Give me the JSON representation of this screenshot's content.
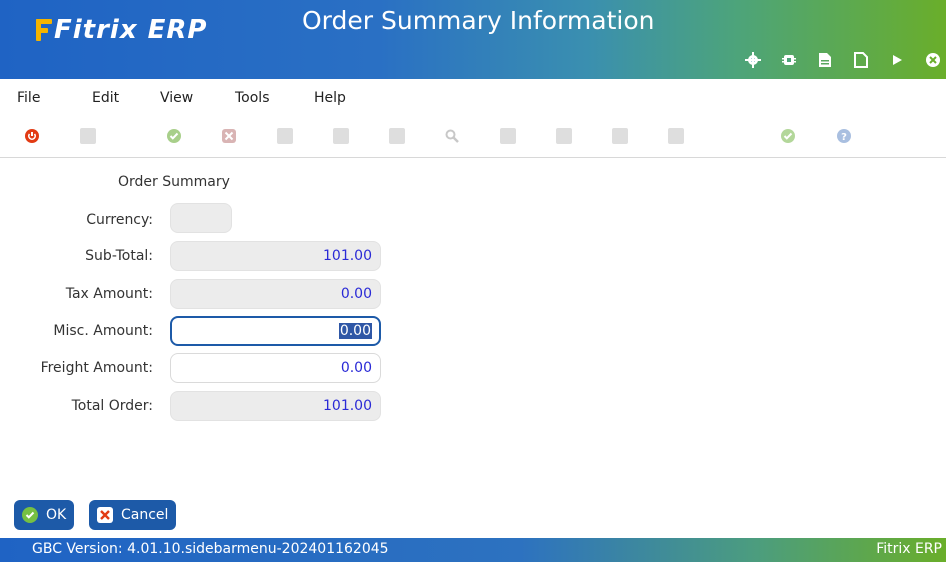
{
  "header": {
    "logo_text": "Fitrix",
    "logo_suffix": "ERP",
    "title": "Order Summary Information",
    "icons": [
      "gear-icon",
      "cpu-icon",
      "document-icon",
      "new-page-icon",
      "play-icon",
      "close-circle-icon"
    ]
  },
  "menu": {
    "items": [
      "File",
      "Edit",
      "View",
      "Tools",
      "Help"
    ]
  },
  "toolbar": {
    "icons": [
      "power-icon",
      "copy-icon",
      "accept-icon",
      "cancel-icon",
      "page-icon",
      "pages-icon",
      "grid-icon",
      "search-icon",
      "calendar-icon",
      "attach-icon",
      "note-icon",
      "calendar2-icon",
      "check-icon",
      "help-icon"
    ]
  },
  "form": {
    "section_title": "Order Summary",
    "currency_label": "Currency:",
    "currency_value": "",
    "subtotal_label": "Sub-Total:",
    "subtotal_value": "101.00",
    "tax_label": "Tax Amount:",
    "tax_value": "0.00",
    "misc_label": "Misc. Amount:",
    "misc_value": "0.00",
    "freight_label": "Freight Amount:",
    "freight_value": "0.00",
    "total_label": "Total Order:",
    "total_value": "101.00"
  },
  "buttons": {
    "ok_label": "OK",
    "cancel_label": "Cancel"
  },
  "status": {
    "version": "GBC Version: 4.01.10.sidebarmenu-202401162045",
    "brand": "Fitrix ERP"
  },
  "colors": {
    "header_start": "#1f63c4",
    "header_end": "#6aae2a",
    "value_text": "#2a2ad6",
    "button_bg": "#1d5aa8",
    "logo_accent": "#f5b400"
  }
}
